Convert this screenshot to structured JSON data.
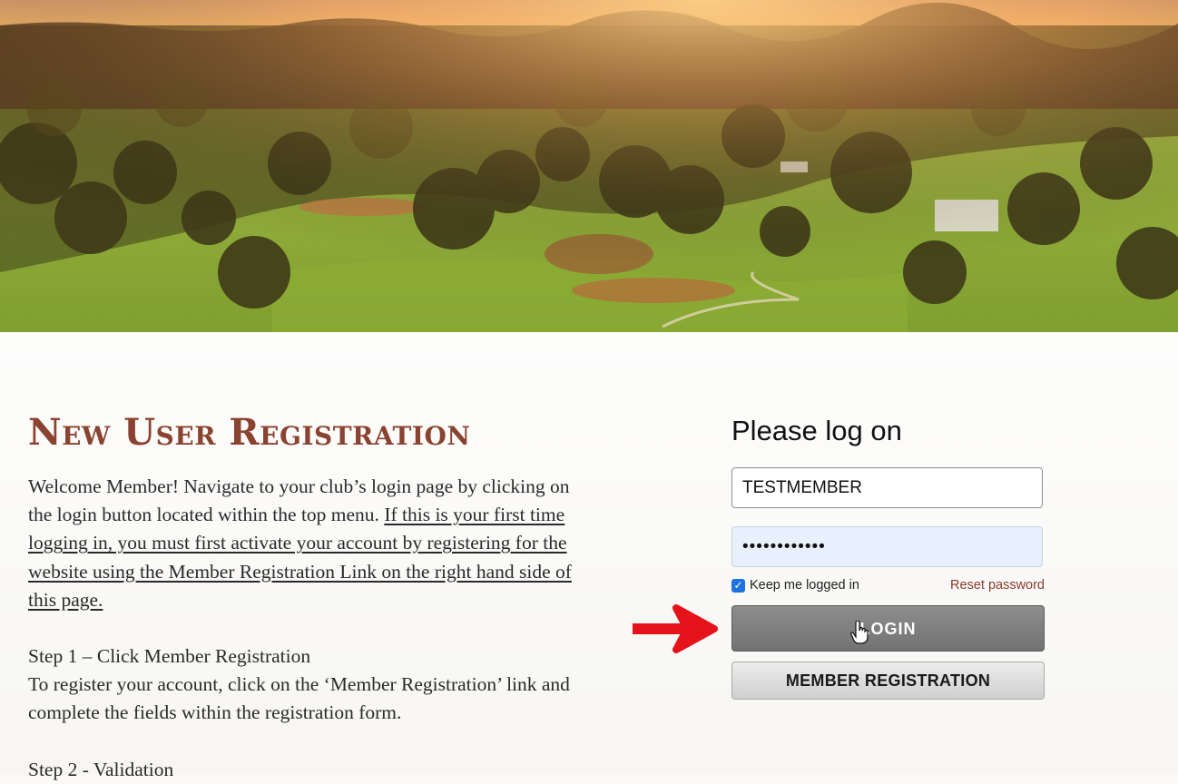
{
  "page": {
    "title": "New User Registration",
    "intro_plain": "Welcome Member! Navigate to your club’s login page by clicking on the login button located within the top menu. ",
    "intro_link": "If this is your first time logging in, you must first activate your account by registering for the website using the Member Registration Link on the right hand side of this page.",
    "step1_heading": "Step 1 – Click Member Registration",
    "step1_text": "To register your account, click on the ‘Member Registration’ link and complete the fields within the registration form.",
    "step2_heading": "Step 2 - Validation"
  },
  "login": {
    "title": "Please log on",
    "username_value": "TESTMEMBER",
    "password_masked": "••••••••••••",
    "keep_logged_in_label": "Keep me logged in",
    "keep_logged_in_checked": true,
    "reset_password_label": "Reset password",
    "login_button": "LOGIN",
    "member_registration_button": "MEMBER REGISTRATION"
  },
  "colors": {
    "title": "#8a4330",
    "reset_link": "#8a3b2c",
    "login_button": "#7f7f7f",
    "arrow": "#e5131a",
    "checkbox": "#1f73e0"
  },
  "icons": {
    "annotation": "red-arrow-icon",
    "pointer": "hand-cursor-icon",
    "checkbox": "checkmark-icon"
  }
}
